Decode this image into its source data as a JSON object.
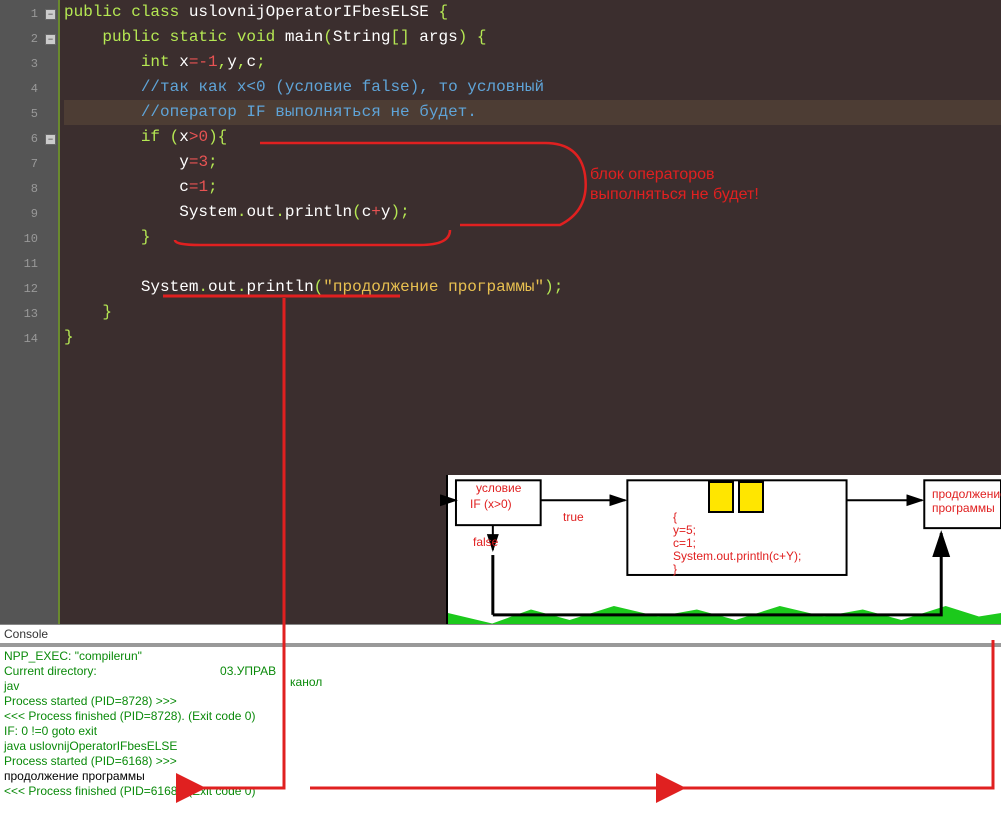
{
  "gutter": {
    "lines": [
      "1",
      "2",
      "3",
      "4",
      "5",
      "6",
      "7",
      "8",
      "9",
      "10",
      "11",
      "12",
      "13",
      "14"
    ]
  },
  "code": {
    "l1": {
      "a": "public class ",
      "b": "uslovnijOperatorIFbesELSE",
      "c": " {"
    },
    "l2": {
      "a": "    public static void ",
      "b": "main",
      "c": "(",
      "d": "String",
      "e": "[] ",
      "f": "args",
      "g": ") {"
    },
    "l3": {
      "a": "        int ",
      "b": "x",
      "c": "=-",
      "d": "1",
      "e": ",",
      "f": "y",
      "g": ",",
      "h": "c",
      "i": ";"
    },
    "l4": {
      "a": "        //так как x<0 (условие false), то условный"
    },
    "l5": {
      "a": "        //оператор IF выполняться не будет."
    },
    "l6": {
      "a": "        if ",
      "b": "(",
      "c": "x",
      "d": ">",
      "e": "0",
      "f": "){"
    },
    "l7": {
      "a": "            y",
      "b": "=",
      "c": "3",
      "d": ";"
    },
    "l8": {
      "a": "            c",
      "b": "=",
      "c": "1",
      "d": ";"
    },
    "l9": {
      "a": "            System",
      "b": ".",
      "c": "out",
      "d": ".",
      "e": "println",
      "f": "(",
      "g": "c",
      "h": "+",
      "i": "y",
      "j": ");"
    },
    "l10": {
      "a": "        }"
    },
    "l11": {
      "a": " "
    },
    "l12": {
      "a": "        System",
      "b": ".",
      "c": "out",
      "d": ".",
      "e": "println",
      "f": "(",
      "g": "\"продолжение программы\"",
      "h": ");"
    },
    "l13": {
      "a": "    }"
    },
    "l14": {
      "a": "}"
    }
  },
  "annotation": {
    "line1": "блок операторов",
    "line2": "выполняться не будет!"
  },
  "console": {
    "title": "Console",
    "l1": "NPP_EXEC: \"compilerun\"",
    "l2a": "Current directory: ",
    "l2b": "03.УПРАВ",
    "l2c": "канол",
    "l3": "jav",
    "l4": "Process started (PID=8728) >>>",
    "l5": "<<< Process finished (PID=8728). (Exit code 0)",
    "l6": "IF: 0 !=0 goto exit",
    "l7": "java uslovnijOperatorIFbesELSE",
    "l8": "Process started (PID=6168) >>>",
    "l9": "продолжение программы",
    "l10": "<<< Process finished (PID=6168). (Exit code 0)"
  },
  "diagram": {
    "cond_top": "условие",
    "cond": "IF (x>0)",
    "true": "true",
    "false": "false",
    "body1": "{",
    "body2": "y=5;",
    "body3": "c=1;",
    "body4": "System.out.println(c+Y);",
    "body5": "}",
    "cont1": "продолжение",
    "cont2": "программы"
  }
}
